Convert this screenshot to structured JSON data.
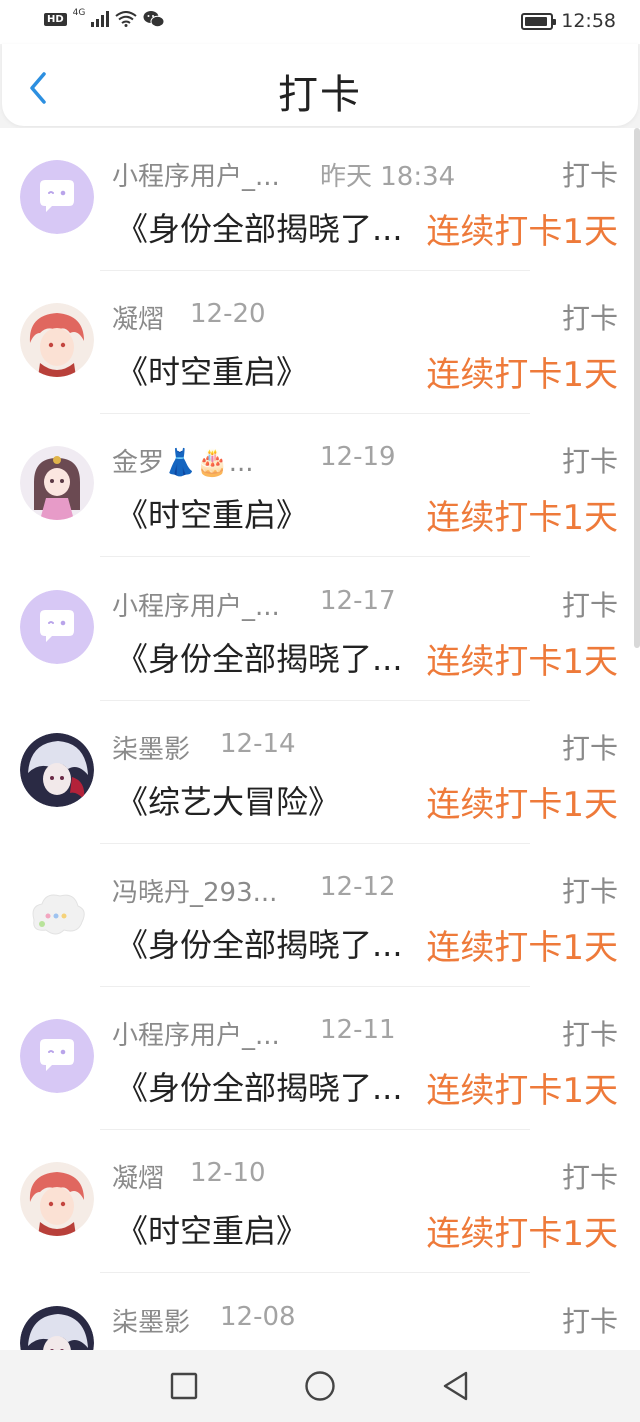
{
  "status_bar": {
    "hd": "HD",
    "network": "4G",
    "battery_level": 0.9,
    "time": "12:58"
  },
  "header": {
    "title": "打卡",
    "back_icon": "chevron-left-icon",
    "accent": "#2c8fe0"
  },
  "list": {
    "type_label": "打卡",
    "items": [
      {
        "name": "小程序用户_...",
        "time": "昨天 18:34",
        "type": "打卡",
        "title": "《身份全部揭晓了...",
        "streak": "连续打卡1天",
        "avatar": "chat-bubble"
      },
      {
        "name": "凝熠",
        "time": "12-20",
        "type": "打卡",
        "title": "《时空重启》",
        "streak": "连续打卡1天",
        "avatar": "red-hair"
      },
      {
        "name": "金罗👗🎂...",
        "time": "12-19",
        "type": "打卡",
        "title": "《时空重启》",
        "streak": "连续打卡1天",
        "avatar": "doll"
      },
      {
        "name": "小程序用户_...",
        "time": "12-17",
        "type": "打卡",
        "title": "《身份全部揭晓了...",
        "streak": "连续打卡1天",
        "avatar": "chat-bubble"
      },
      {
        "name": "柒墨影",
        "time": "12-14",
        "type": "打卡",
        "title": "《综艺大冒险》",
        "streak": "连续打卡1天",
        "avatar": "white-hair"
      },
      {
        "name": "冯晓丹_293...",
        "time": "12-12",
        "type": "打卡",
        "title": "《身份全部揭晓了...",
        "streak": "连续打卡1天",
        "avatar": "cloud"
      },
      {
        "name": "小程序用户_...",
        "time": "12-11",
        "type": "打卡",
        "title": "《身份全部揭晓了...",
        "streak": "连续打卡1天",
        "avatar": "chat-bubble"
      },
      {
        "name": "凝熠",
        "time": "12-10",
        "type": "打卡",
        "title": "《时空重启》",
        "streak": "连续打卡1天",
        "avatar": "red-hair"
      },
      {
        "name": "柒墨影",
        "time": "12-08",
        "type": "打卡",
        "title": "",
        "streak": "",
        "avatar": "white-hair"
      }
    ]
  },
  "colors": {
    "streak": "#ee7a3a",
    "name": "#8a8a8a",
    "title": "#222222",
    "avatar_purple": "#d7c8f5"
  },
  "nav": {
    "recent_icon": "square-icon",
    "home_icon": "circle-icon",
    "back_icon": "triangle-back-icon"
  }
}
